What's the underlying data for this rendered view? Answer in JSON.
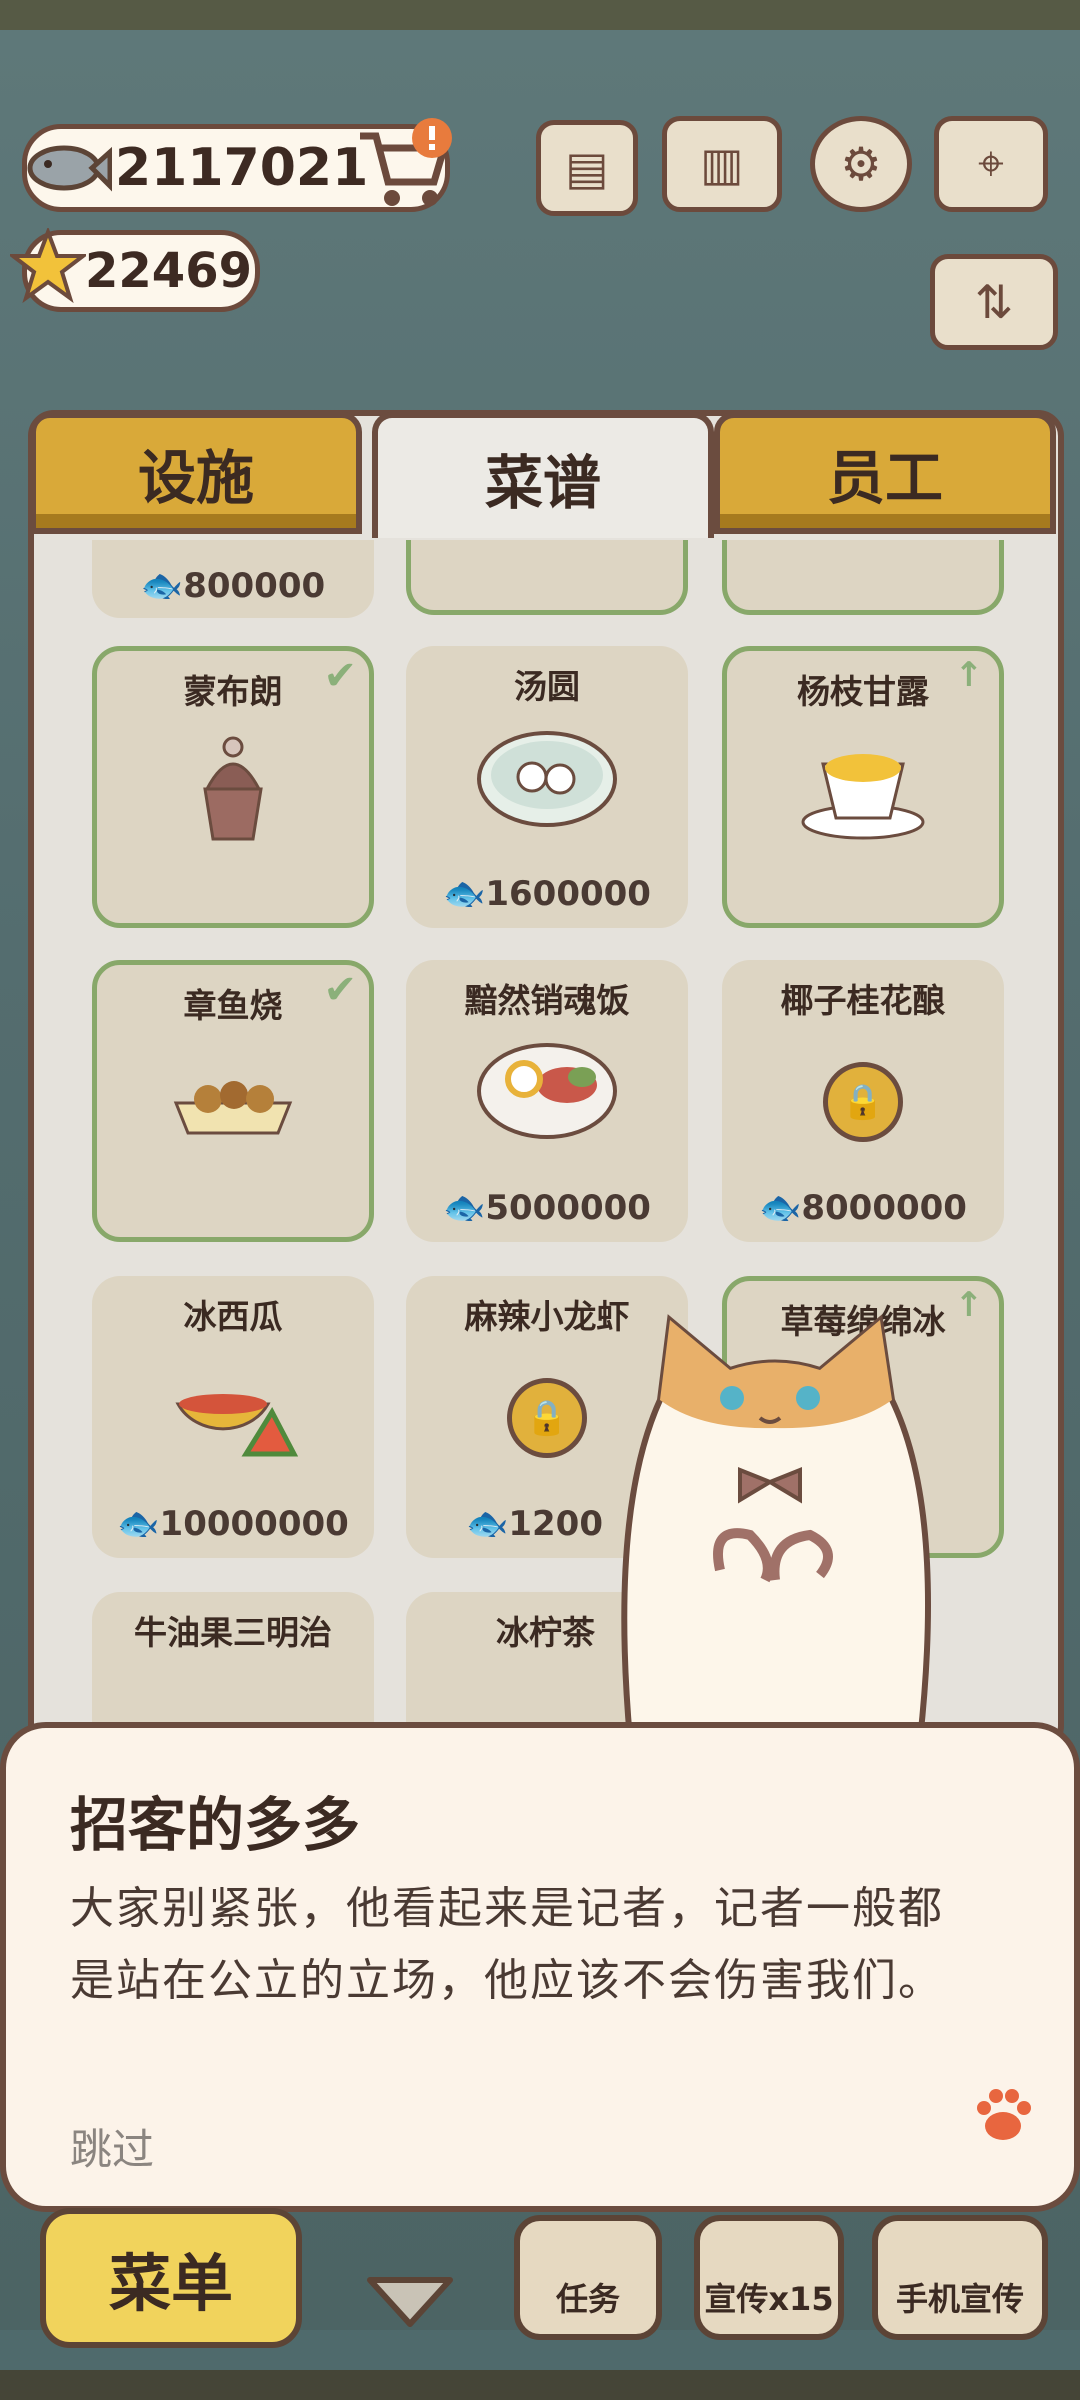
{
  "currency": {
    "fish": "2117021",
    "stars": "22469"
  },
  "tabs": [
    {
      "label": "设施"
    },
    {
      "label": "菜谱"
    },
    {
      "label": "员工"
    }
  ],
  "row0": {
    "price_left": "800000"
  },
  "recipes": [
    {
      "name": "蒙布朗",
      "price": ""
    },
    {
      "name": "汤圆",
      "price": "1600000"
    },
    {
      "name": "杨枝甘露",
      "price": ""
    },
    {
      "name": "章鱼烧",
      "price": ""
    },
    {
      "name": "黯然销魂饭",
      "price": "5000000"
    },
    {
      "name": "椰子桂花酿",
      "price": "8000000"
    },
    {
      "name": "冰西瓜",
      "price": "10000000"
    },
    {
      "name": "麻辣小龙虾",
      "price": "1200"
    },
    {
      "name": "草莓绵绵冰",
      "price": ""
    },
    {
      "name": "牛油果三明治",
      "price": ""
    },
    {
      "name": "冰柠茶",
      "price": ""
    }
  ],
  "dialog": {
    "speaker": "招客的多多",
    "line1": "大家别紧张，他看起来是记者，记者一般都",
    "line2": "是站在公立的立场，他应该不会伤害我们。",
    "skip": "跳过"
  },
  "bottom": {
    "menu": "菜单",
    "task": "任务",
    "promo": "宣传x15",
    "phone_promo": "手机宣传"
  },
  "colors": {
    "tab_gold": "#d9a939",
    "card_bg": "#ddd5c3",
    "owned_border": "#88a86a",
    "dialog_bg": "#fcf3e9"
  }
}
